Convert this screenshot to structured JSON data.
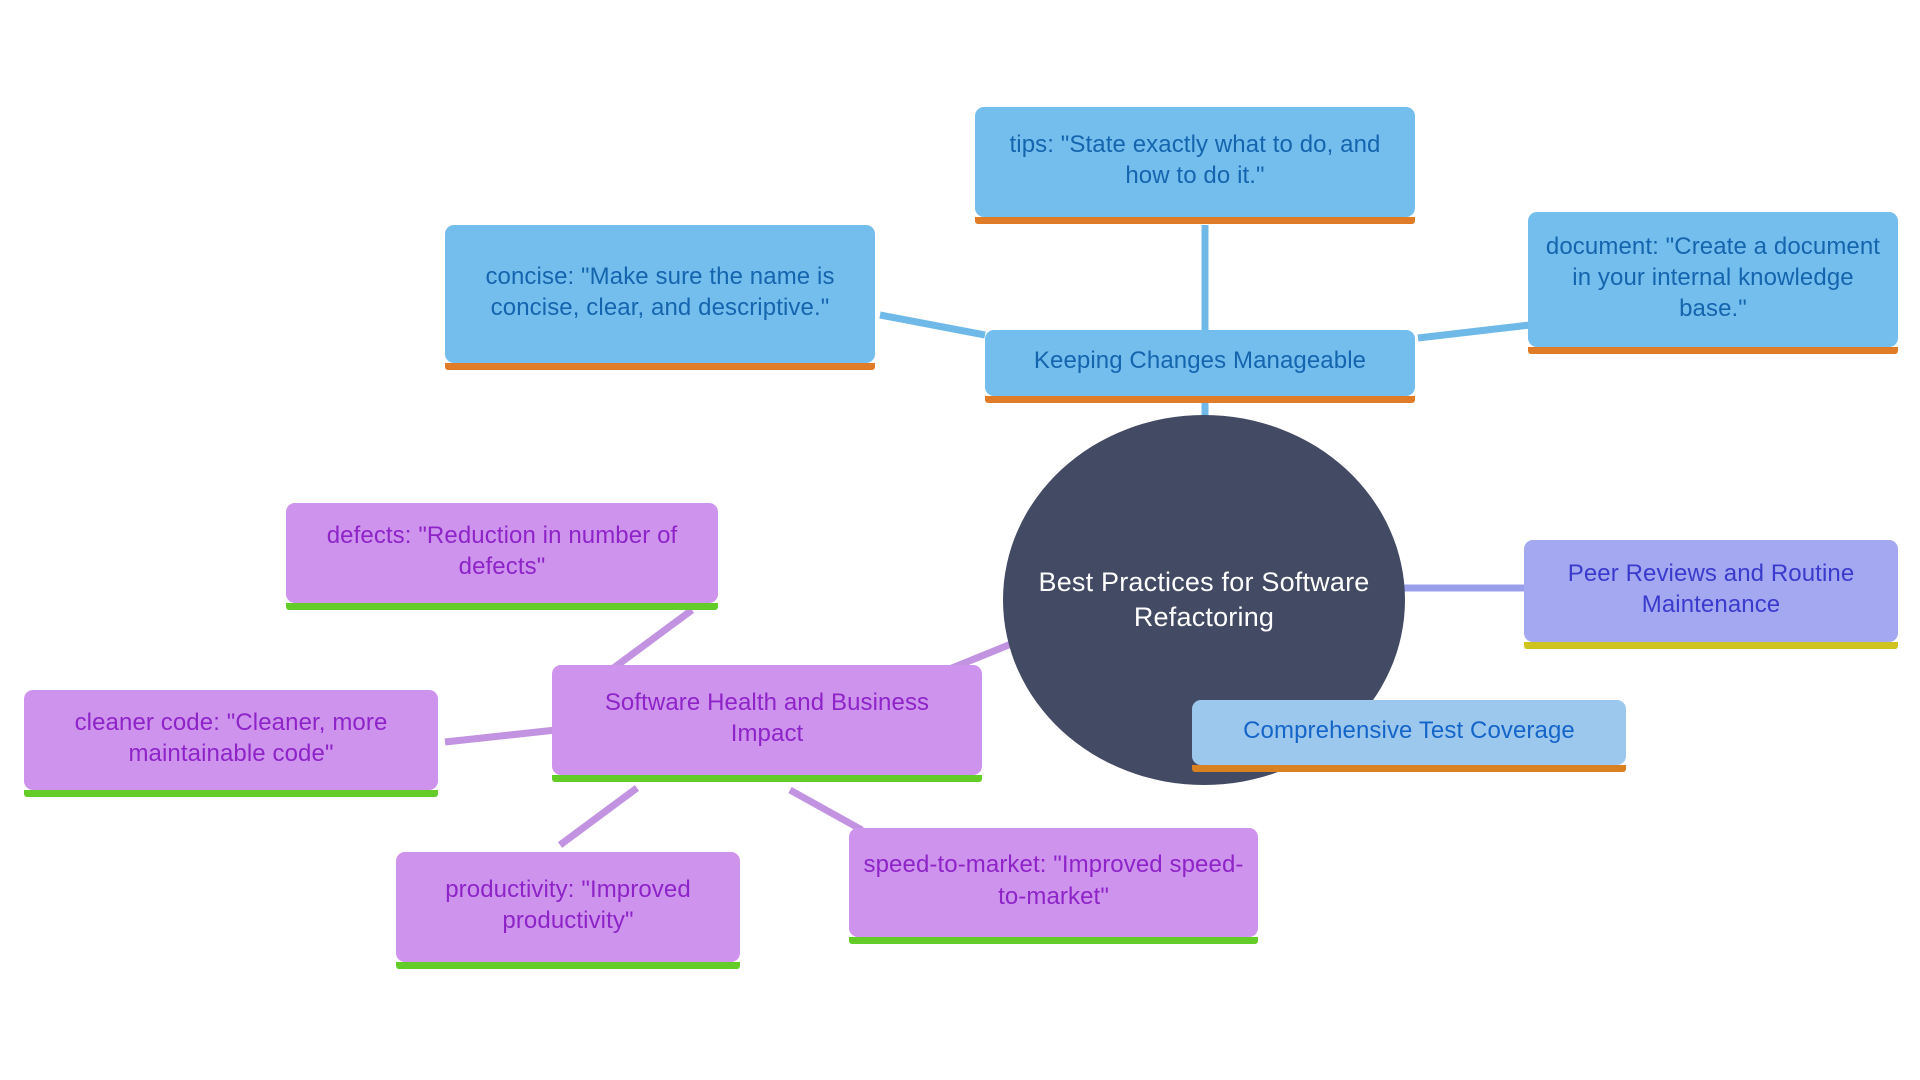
{
  "diagram": {
    "type": "mind-map",
    "background": "#ffffff",
    "root": {
      "label": "Best Practices for Software Refactoring",
      "fill": "#434A63",
      "text_color": "#ffffff"
    },
    "branches": [
      {
        "id": "keeping-changes-manageable",
        "label": "Keeping Changes Manageable",
        "fill": "#74BEEE",
        "text_color": "#1565AE",
        "accent": "#E07B28",
        "children": [
          {
            "id": "tips",
            "label": "tips: \"State exactly what to do, and how to do it.\"",
            "fill": "#74BEEE",
            "text_color": "#1565AE",
            "accent": "#E07B28"
          },
          {
            "id": "concise",
            "label": "concise: \"Make sure the name is concise, clear, and descriptive.\"",
            "fill": "#74BEEE",
            "text_color": "#1565AE",
            "accent": "#E07B28"
          },
          {
            "id": "document",
            "label": "document: \"Create a document in your internal knowledge base.\"",
            "fill": "#74BEEE",
            "text_color": "#1565AE",
            "accent": "#E07B28"
          }
        ]
      },
      {
        "id": "peer-reviews-and-routine-maintenance",
        "label": "Peer Reviews and Routine Maintenance",
        "fill": "#A3A8F0",
        "text_color": "#3A3ACC",
        "accent": "#CFC41F",
        "children": []
      },
      {
        "id": "comprehensive-test-coverage",
        "label": "Comprehensive Test Coverage",
        "fill": "#9CC8EE",
        "text_color": "#1565C8",
        "accent": "#D98020",
        "children": []
      },
      {
        "id": "software-health-and-business-impact",
        "label": "Software Health and Business Impact",
        "fill": "#CE93ED",
        "text_color": "#8E24C8",
        "accent": "#63CC28",
        "children": [
          {
            "id": "defects",
            "label": "defects: \"Reduction in number of defects\"",
            "fill": "#CE93ED",
            "text_color": "#8E24C8",
            "accent": "#63CC28"
          },
          {
            "id": "cleaner-code",
            "label": "cleaner code: \"Cleaner, more maintainable code\"",
            "fill": "#CE93ED",
            "text_color": "#8E24C8",
            "accent": "#63CC28"
          },
          {
            "id": "productivity",
            "label": "productivity: \"Improved productivity\"",
            "fill": "#CE93ED",
            "text_color": "#8E24C8",
            "accent": "#63CC28"
          },
          {
            "id": "speed-to-market",
            "label": "speed-to-market: \"Improved speed-to-market\"",
            "fill": "#CE93ED",
            "text_color": "#8E24C8",
            "accent": "#63CC28"
          }
        ]
      }
    ],
    "connector_colors": {
      "blue": "#6FB9E8",
      "purple": "#C293E0",
      "periwinkle": "#9A9FEC"
    }
  }
}
